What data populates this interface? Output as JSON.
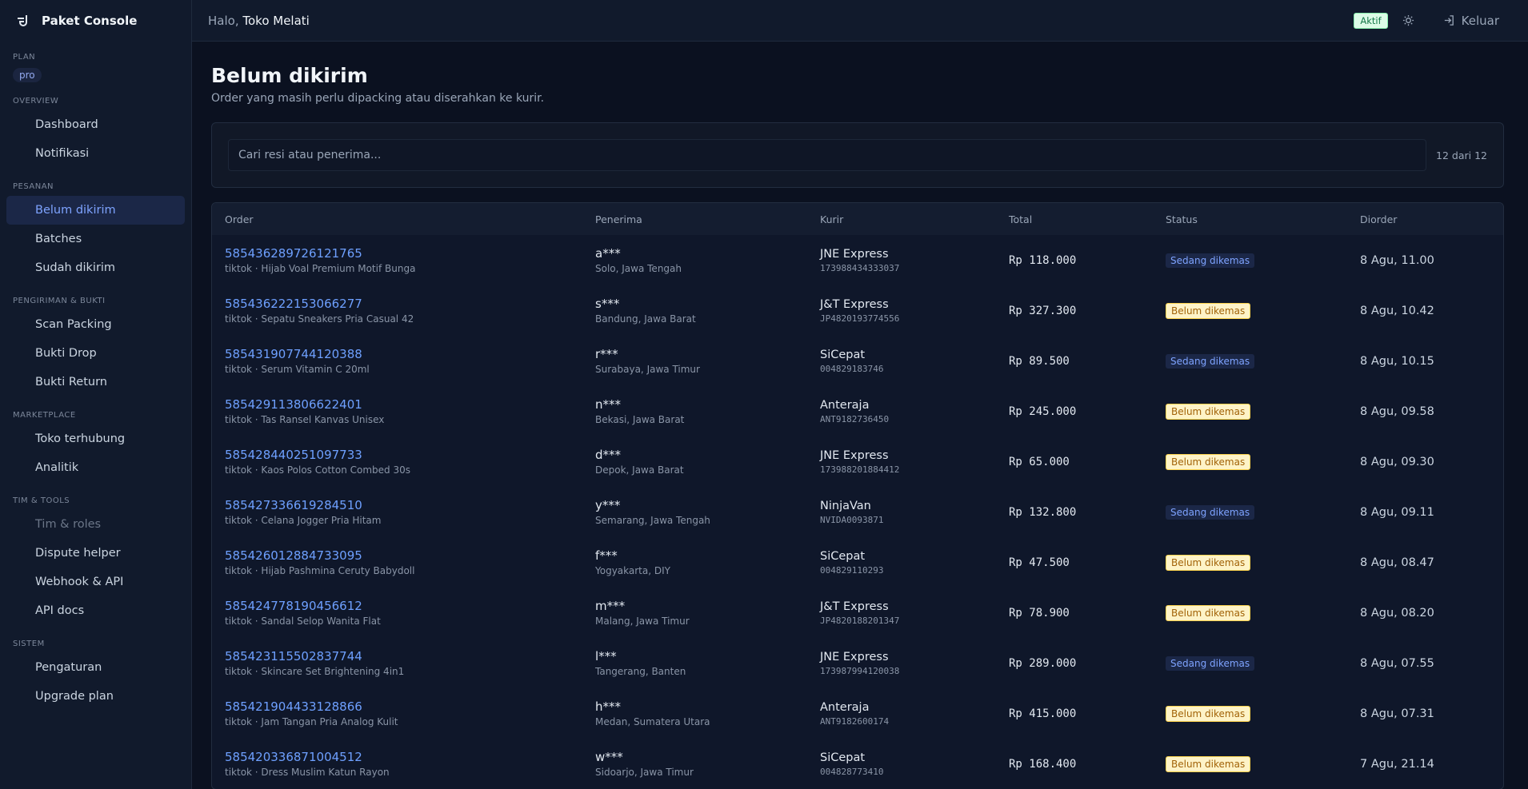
{
  "app": {
    "title": "Paket Console"
  },
  "sidebar": {
    "plan_label": "PLAN",
    "plan_value": "pro",
    "sections": [
      {
        "label": "OVERVIEW",
        "items": [
          {
            "label": "Dashboard",
            "icon": "dashboard-icon"
          },
          {
            "label": "Notifikasi",
            "icon": "bell-icon"
          }
        ]
      },
      {
        "label": "PESANAN",
        "items": [
          {
            "label": "Belum dikirim",
            "icon": "box-icon",
            "active": true
          },
          {
            "label": "Batches",
            "icon": "layers-icon"
          },
          {
            "label": "Sudah dikirim",
            "icon": "truck-icon"
          }
        ]
      },
      {
        "label": "PENGIRIMAN & BUKTI",
        "items": [
          {
            "label": "Scan Packing",
            "icon": "camera-icon"
          },
          {
            "label": "Bukti Drop",
            "icon": "truck-icon"
          },
          {
            "label": "Bukti Return",
            "icon": "undo-icon"
          }
        ]
      },
      {
        "label": "MARKETPLACE",
        "items": [
          {
            "label": "Toko terhubung",
            "icon": "store-icon"
          },
          {
            "label": "Analitik",
            "icon": "chart-line-icon"
          }
        ]
      },
      {
        "label": "TIM & TOOLS",
        "items": [
          {
            "label": "Tim & roles",
            "icon": "users-icon",
            "locked": true
          },
          {
            "label": "Dispute helper",
            "icon": "file-icon"
          },
          {
            "label": "Webhook & API",
            "icon": "link-icon"
          },
          {
            "label": "API docs",
            "icon": "code-icon"
          }
        ]
      },
      {
        "label": "SISTEM",
        "items": [
          {
            "label": "Pengaturan",
            "icon": "gear-icon"
          },
          {
            "label": "Upgrade plan",
            "icon": "sparkle-icon"
          }
        ]
      }
    ]
  },
  "topbar": {
    "greeting": "Halo,",
    "store_name": "Toko Melati",
    "status_badge": "Aktif",
    "logout_label": "Keluar"
  },
  "page": {
    "title": "Belum dikirim",
    "subtitle": "Order yang masih perlu dipacking atau diserahkan ke kurir."
  },
  "search": {
    "placeholder": "Cari resi atau penerima...",
    "count": "12 dari 12"
  },
  "table": {
    "columns": [
      "Order",
      "Penerima",
      "Kurir",
      "Total",
      "Status",
      "Diorder"
    ],
    "rows": [
      {
        "order_id": "585436289726121765",
        "product": "tiktok · Hijab Voal Premium Motif Bunga",
        "name": "a***",
        "city": "Solo, Jawa Tengah",
        "courier": "JNE Express",
        "resi": "173988434333037",
        "total": "Rp 118.000",
        "status": "Sedang dikemas",
        "status_type": "packing",
        "date": "8 Agu, 11.00"
      },
      {
        "order_id": "585436222153066277",
        "product": "tiktok · Sepatu Sneakers Pria Casual 42",
        "name": "s***",
        "city": "Bandung, Jawa Barat",
        "courier": "J&T Express",
        "resi": "JP4820193774556",
        "total": "Rp 327.300",
        "status": "Belum dikemas",
        "status_type": "pending",
        "date": "8 Agu, 10.42"
      },
      {
        "order_id": "585431907744120388",
        "product": "tiktok · Serum Vitamin C 20ml",
        "name": "r***",
        "city": "Surabaya, Jawa Timur",
        "courier": "SiCepat",
        "resi": "004829183746",
        "total": "Rp 89.500",
        "status": "Sedang dikemas",
        "status_type": "packing",
        "date": "8 Agu, 10.15"
      },
      {
        "order_id": "585429113806622401",
        "product": "tiktok · Tas Ransel Kanvas Unisex",
        "name": "n***",
        "city": "Bekasi, Jawa Barat",
        "courier": "Anteraja",
        "resi": "ANT9182736450",
        "total": "Rp 245.000",
        "status": "Belum dikemas",
        "status_type": "pending",
        "date": "8 Agu, 09.58"
      },
      {
        "order_id": "585428440251097733",
        "product": "tiktok · Kaos Polos Cotton Combed 30s",
        "name": "d***",
        "city": "Depok, Jawa Barat",
        "courier": "JNE Express",
        "resi": "173988201884412",
        "total": "Rp 65.000",
        "status": "Belum dikemas",
        "status_type": "pending",
        "date": "8 Agu, 09.30"
      },
      {
        "order_id": "585427336619284510",
        "product": "tiktok · Celana Jogger Pria Hitam",
        "name": "y***",
        "city": "Semarang, Jawa Tengah",
        "courier": "NinjaVan",
        "resi": "NVIDA0093871",
        "total": "Rp 132.800",
        "status": "Sedang dikemas",
        "status_type": "packing",
        "date": "8 Agu, 09.11"
      },
      {
        "order_id": "585426012884733095",
        "product": "tiktok · Hijab Pashmina Ceruty Babydoll",
        "name": "f***",
        "city": "Yogyakarta, DIY",
        "courier": "SiCepat",
        "resi": "004829110293",
        "total": "Rp 47.500",
        "status": "Belum dikemas",
        "status_type": "pending",
        "date": "8 Agu, 08.47"
      },
      {
        "order_id": "585424778190456612",
        "product": "tiktok · Sandal Selop Wanita Flat",
        "name": "m***",
        "city": "Malang, Jawa Timur",
        "courier": "J&T Express",
        "resi": "JP4820188201347",
        "total": "Rp 78.900",
        "status": "Belum dikemas",
        "status_type": "pending",
        "date": "8 Agu, 08.20"
      },
      {
        "order_id": "585423115502837744",
        "product": "tiktok · Skincare Set Brightening 4in1",
        "name": "l***",
        "city": "Tangerang, Banten",
        "courier": "JNE Express",
        "resi": "173987994120038",
        "total": "Rp 289.000",
        "status": "Sedang dikemas",
        "status_type": "packing",
        "date": "8 Agu, 07.55"
      },
      {
        "order_id": "585421904433128866",
        "product": "tiktok · Jam Tangan Pria Analog Kulit",
        "name": "h***",
        "city": "Medan, Sumatera Utara",
        "courier": "Anteraja",
        "resi": "ANT9182600174",
        "total": "Rp 415.000",
        "status": "Belum dikemas",
        "status_type": "pending",
        "date": "8 Agu, 07.31"
      },
      {
        "order_id": "585420336871004512",
        "product": "tiktok · Dress Muslim Katun Rayon",
        "name": "w***",
        "city": "Sidoarjo, Jawa Timur",
        "courier": "SiCepat",
        "resi": "004828773410",
        "total": "Rp 168.400",
        "status": "Belum dikemas",
        "status_type": "pending",
        "date": "7 Agu, 21.14"
      }
    ]
  }
}
